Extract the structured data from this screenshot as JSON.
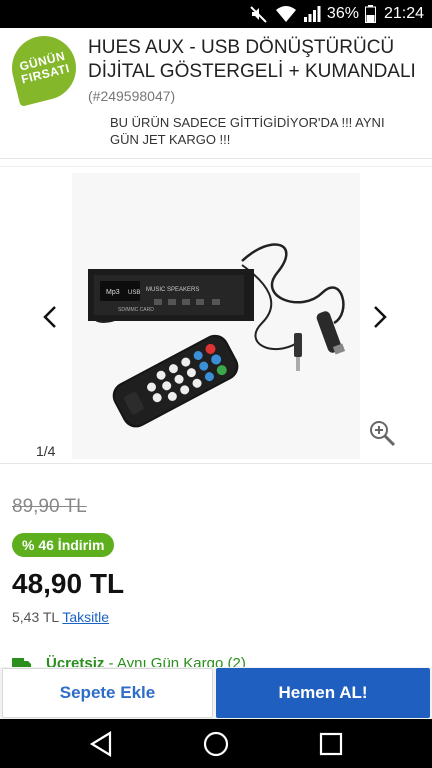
{
  "status_bar": {
    "battery": "36%",
    "time": "21:24"
  },
  "header": {
    "badge_line1": "GÜNÜN",
    "badge_line2": "FIRSATI",
    "title": "HUES AUX - USB DÖNÜŞTÜRÜCÜ DİJİTAL GÖSTERGELİ + KUMANDALI ",
    "product_code": "(#249598047)",
    "subtitle": "BU ÜRÜN SADECE GİTTİGİDİYOR'DA !!! AYNI GÜN JET KARGO !!!"
  },
  "gallery": {
    "pager": "1/4",
    "photo_labels": {
      "mp3": "Mp3",
      "usb": "USB",
      "music": "MUSIC SPEAKERS",
      "card": "SD/MMC CARD"
    }
  },
  "price": {
    "old_price": "89,90 TL",
    "discount": "% 46 İndirim",
    "current_price": "48,90 TL",
    "installment_amount": "5,43 TL",
    "installment_link": "Taksitle"
  },
  "shipping": {
    "free": "Ücretsiz",
    "rest": " - Aynı Gün Kargo ",
    "count": "(2)"
  },
  "actions": {
    "add_to_cart": "Sepete Ekle",
    "buy_now": "Hemen AL!"
  },
  "colors": {
    "badge_green": "#84b82a",
    "discount_green": "#5daf1d",
    "primary_blue": "#1f5fbf",
    "link_blue": "#1a63c6"
  }
}
